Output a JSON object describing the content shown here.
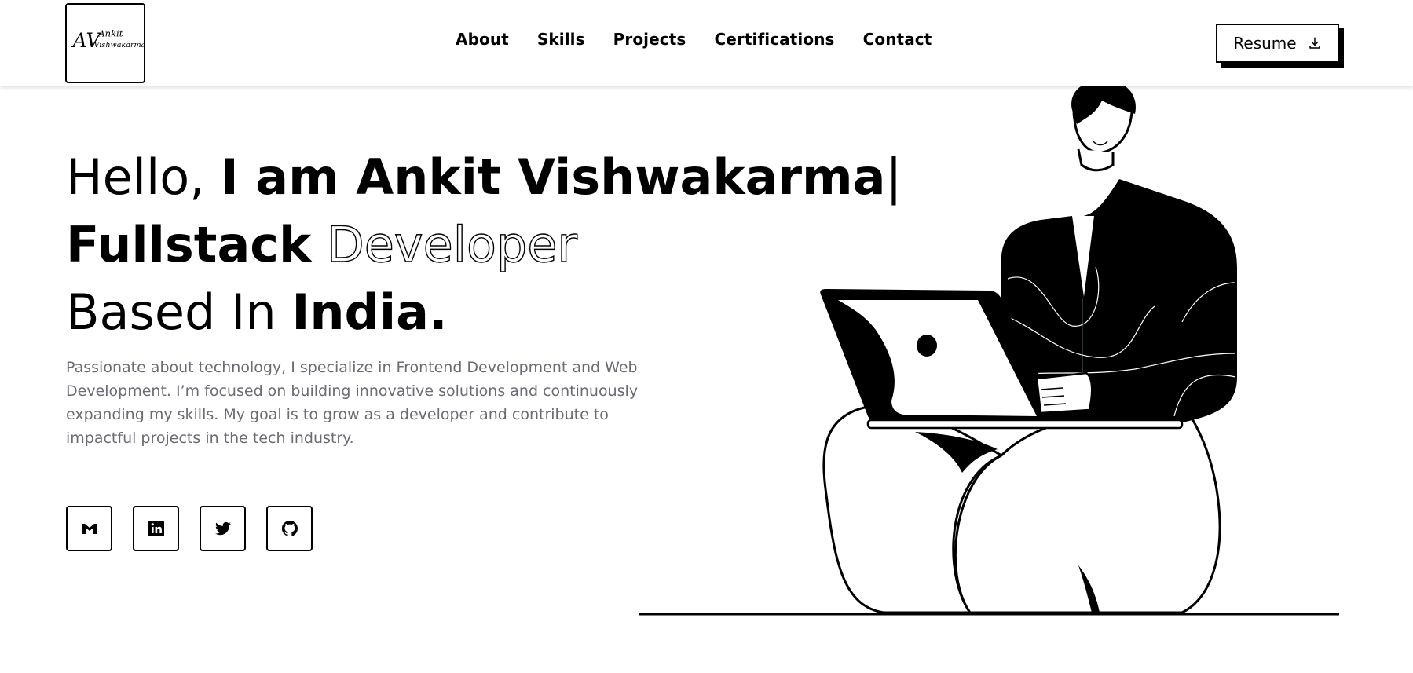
{
  "header": {
    "logo": {
      "initials": "AV",
      "line1": "Ankit",
      "line2": "Vishwakarma"
    },
    "nav": [
      "About",
      "Skills",
      "Projects",
      "Certifications",
      "Contact"
    ],
    "resume_label": "Resume",
    "resume_icon": "download-icon"
  },
  "hero": {
    "greeting": "Hello,",
    "intro_name": "I am Ankit Vishwakarma",
    "cursor": "|",
    "role_bold": "Fullstack",
    "role_outline": "Developer",
    "based_light": "Based In",
    "based_bold": "India.",
    "description": "Passionate about technology, I specialize in Frontend Development and Web Development. I’m focused on building innovative solutions and continuously expanding my skills. My goal is to grow as a developer and contribute to impactful projects in the tech industry."
  },
  "socials": [
    {
      "icon": "gmail-icon"
    },
    {
      "icon": "linkedin-icon"
    },
    {
      "icon": "twitter-icon"
    },
    {
      "icon": "github-icon"
    }
  ],
  "colors": {
    "text": "#000000",
    "muted_text": "#6b6b73",
    "background": "#ffffff"
  }
}
